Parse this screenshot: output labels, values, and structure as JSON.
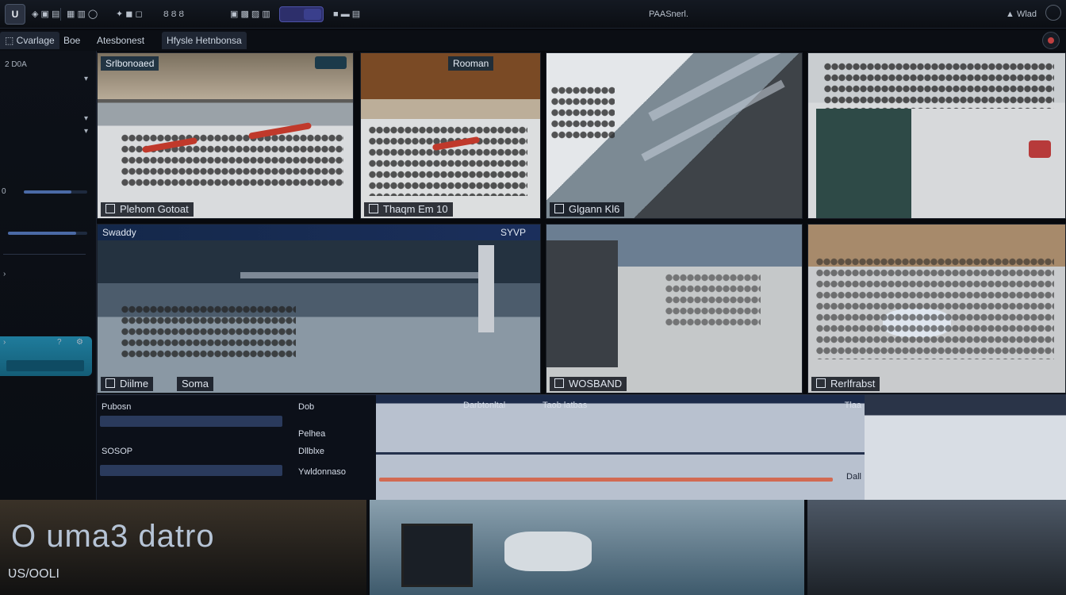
{
  "app": {
    "logo_text": "U",
    "center_title": "PAASnerl.",
    "right_label": "Wlad"
  },
  "toolbar": {
    "items": [
      "◈ ▣ ▤",
      "▦ ▥ ◯",
      "✦ ◼ ◻",
      "Ȣ Ȣ Ȣ",
      "▣ ▩ ▨ ▥",
      "■ ▬ ▤"
    ]
  },
  "tabs": [
    "Cvarlage",
    "Boe",
    "Atesbonest",
    "Hfysle Hetnbonsa"
  ],
  "sidebar": {
    "lines": [
      "2 D0A",
      "",
      "",
      "",
      "",
      "0",
      "",
      "",
      ""
    ]
  },
  "cameras": [
    {
      "tag": "Srlbonoaed",
      "label": "Plehom Gotoat"
    },
    {
      "tag": "Rooman",
      "label": "Thaqm Em 10"
    },
    {
      "tag": "",
      "label": "Glgann Kl6"
    },
    {
      "tag": "",
      "label": ""
    },
    {
      "tag": "Swaddy",
      "tag_right": "SYVP",
      "label": "Diilme",
      "label_right": "Soma"
    },
    {
      "tag": "",
      "label": "WOSBAND"
    },
    {
      "tag": "",
      "label": "Rerlfrabst"
    }
  ],
  "panel": {
    "rows_left": [
      "Pubosn",
      "",
      "SOSOP",
      ""
    ],
    "rows_mid": [
      "Dob",
      "Pelhea",
      "Dllblxe",
      "Ywldonnaso"
    ],
    "track_title": "Darbtonltal",
    "track_title_right": "Taob latbas",
    "track_tag": "Tlaa",
    "track_tag_bottom": "Dall"
  },
  "bottom": {
    "title": "O uma3 datro",
    "subtitle": "ƲS/OOLI"
  },
  "colors": {
    "accent": "#1f7c9c",
    "toolbar_bg": "#141922",
    "plane_red": "#c0392b"
  }
}
